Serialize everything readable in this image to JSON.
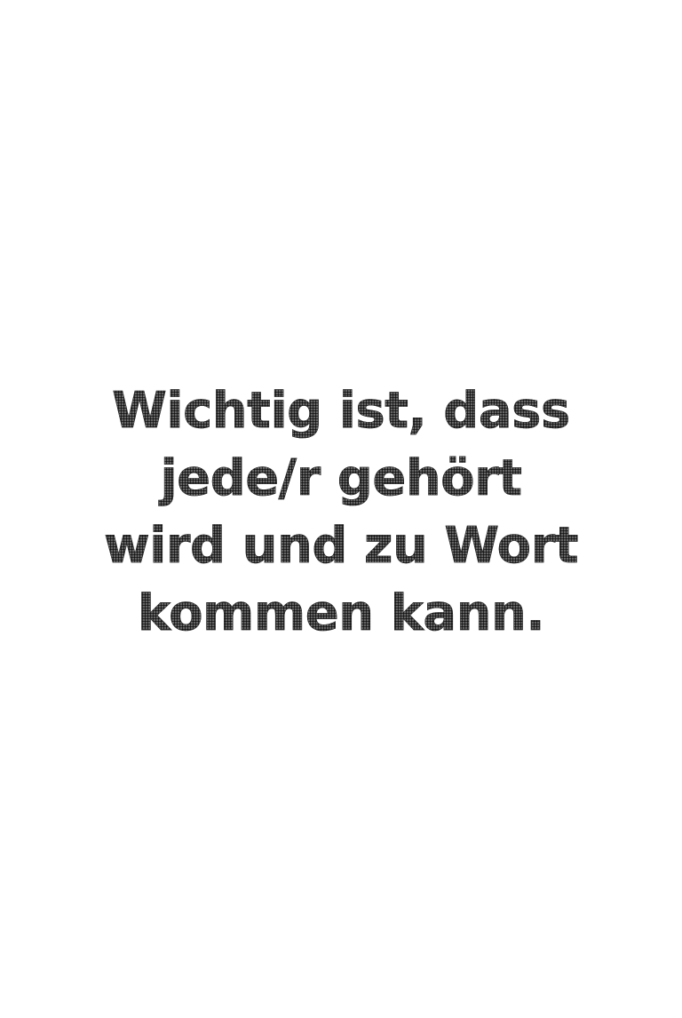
{
  "quote": {
    "lines": [
      "Wichtig ist, dass",
      "jede/r gehört",
      "wird und zu Wort",
      "kommen kann."
    ]
  },
  "colors": {
    "background": "#ffffff",
    "text": "#1a1a1a"
  }
}
